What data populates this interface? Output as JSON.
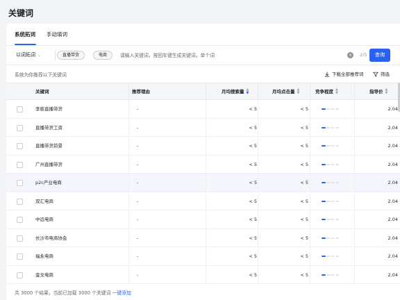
{
  "page_title": "关键词",
  "tabs": [
    {
      "label": "系统拓词",
      "active": true
    },
    {
      "label": "手动填词",
      "active": false
    }
  ],
  "search": {
    "mode_label": "以词拓词",
    "tags": [
      "直播带货",
      "电商"
    ],
    "placeholder": "请输入关键词，按回车键生成关键词，单个词",
    "count": "2/5",
    "query_label": "查询"
  },
  "info": {
    "recommend_text": "系统为你推荐以下关键词",
    "download_label": "下载全部推荐词",
    "filter_label": "筛选"
  },
  "table": {
    "columns": [
      "关键词",
      "推荐理由",
      "月均搜索量",
      "月均点击量",
      "竞争程度",
      "指导价"
    ],
    "rows": [
      {
        "keyword": "李慈直播带货",
        "reason": "-",
        "search": "< 5",
        "clicks": "< 5",
        "competition": 0.25,
        "price": "2.04"
      },
      {
        "keyword": "直播带货工资",
        "reason": "-",
        "search": "< 5",
        "clicks": "< 5",
        "competition": 0.25,
        "price": "2.04"
      },
      {
        "keyword": "直播带货前景",
        "reason": "-",
        "search": "< 5",
        "clicks": "< 5",
        "competition": 0.25,
        "price": "2.04"
      },
      {
        "keyword": "广州直播带货",
        "reason": "-",
        "search": "< 5",
        "clicks": "< 5",
        "competition": 0.25,
        "price": "2.04"
      },
      {
        "keyword": "p2c产业电商",
        "reason": "-",
        "search": "< 5",
        "clicks": "< 5",
        "competition": 0.25,
        "price": "2.04"
      },
      {
        "keyword": "双汇电商",
        "reason": "-",
        "search": "< 5",
        "clicks": "< 5",
        "competition": 0.25,
        "price": "2.04"
      },
      {
        "keyword": "中远电商",
        "reason": "-",
        "search": "< 5",
        "clicks": "< 5",
        "competition": 0.25,
        "price": "2.04"
      },
      {
        "keyword": "长沙市电商协会",
        "reason": "-",
        "search": "< 5",
        "clicks": "< 5",
        "competition": 0.25,
        "price": "2.04"
      },
      {
        "keyword": "福永电商",
        "reason": "-",
        "search": "< 5",
        "clicks": "< 5",
        "competition": 0.25,
        "price": "2.04"
      },
      {
        "keyword": "金文电商",
        "reason": "-",
        "search": "< 5",
        "clicks": "< 5",
        "competition": 0.25,
        "price": "2.04"
      }
    ]
  },
  "footer": {
    "summary": "共 3000 个结果，当前已加载 3000 个关键词",
    "link_label": "一键添加"
  },
  "colors": {
    "accent": "#2a62f0",
    "header_bg": "#f5f6f7",
    "highlight_row": "#f4f6fb"
  }
}
